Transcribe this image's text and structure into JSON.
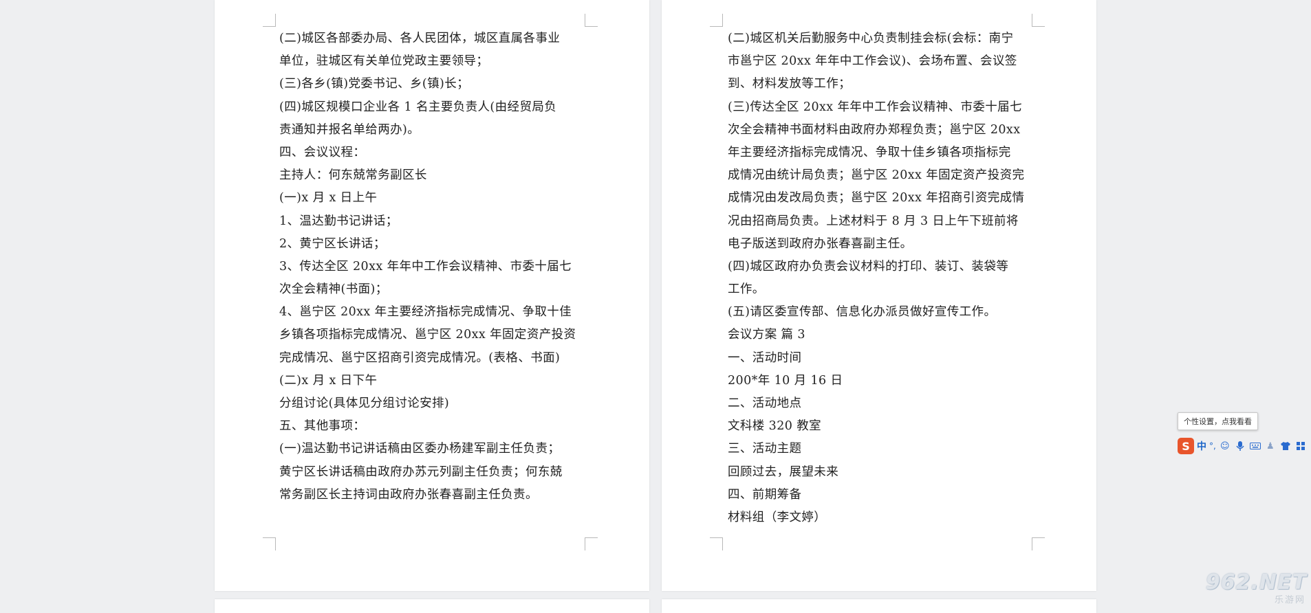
{
  "document": {
    "left_page": {
      "lines": [
        "(二)城区各部委办局、各人民团体，城区直属各事业",
        "单位，驻城区有关单位党政主要领导；",
        "(三)各乡(镇)党委书记、乡(镇)长；",
        "(四)城区规模口企业各 1 名主要负责人(由经贸局负",
        "责通知并报名单给两办)。",
        "四、会议议程：",
        "主持人：何东兢常务副区长",
        "(一)x 月 x 日上午",
        "1、温达勤书记讲话；",
        "2、黄宁区长讲话；",
        "3、传达全区 20xx 年年中工作会议精神、市委十届七",
        "次全会精神(书面)；",
        "4、邕宁区 20xx 年主要经济指标完成情况、争取十佳",
        "乡镇各项指标完成情况、邕宁区 20xx 年固定资产投资",
        "完成情况、邕宁区招商引资完成情况。(表格、书面)",
        "(二)x 月 x 日下午",
        "分组讨论(具体见分组讨论安排)",
        "五、其他事项：",
        "(一)温达勤书记讲话稿由区委办杨建军副主任负责；",
        "黄宁区长讲话稿由政府办苏元列副主任负责；何东兢",
        "常务副区长主持词由政府办张春喜副主任负责。"
      ]
    },
    "right_page": {
      "lines": [
        "(二)城区机关后勤服务中心负责制挂会标(会标：南宁",
        "市邕宁区 20xx 年年中工作会议)、会场布置、会议签",
        "到、材料发放等工作；",
        "(三)传达全区 20xx 年年中工作会议精神、市委十届七",
        "次全会精神书面材料由政府办郑程负责；邕宁区 20xx",
        "年主要经济指标完成情况、争取十佳乡镇各项指标完",
        "成情况由统计局负责；邕宁区 20xx 年固定资产投资完",
        "成情况由发改局负责；邕宁区 20xx 年招商引资完成情",
        "况由招商局负责。上述材料于 8 月 3 日上午下班前将",
        "电子版送到政府办张春喜副主任。",
        "(四)城区政府办负责会议材料的打印、装订、装袋等",
        "工作。",
        "(五)请区委宣传部、信息化办派员做好宣传工作。",
        "会议方案  篇 3",
        "一、活动时间",
        "200*年 10 月 16 日",
        "二、活动地点",
        "文科楼 320 教室",
        "三、活动主题",
        "回顾过去，展望未来",
        "四、前期筹备",
        "材料组（李文婷）"
      ]
    }
  },
  "ime": {
    "tooltip": "个性设置，点我看看",
    "logo": "S",
    "mode": "中",
    "punct": "°,",
    "icons": [
      "smile-icon",
      "microphone-icon",
      "keyboard-icon",
      "user-icon",
      "shirt-icon",
      "grid-icon"
    ]
  },
  "watermark": {
    "brand": "962.NET",
    "sub": "乐游网"
  },
  "colors": {
    "background": "#eeeff1",
    "page": "#ffffff",
    "text": "#222222",
    "ime_logo": "#e8552c",
    "ime_icons": "#2a6bcf"
  }
}
